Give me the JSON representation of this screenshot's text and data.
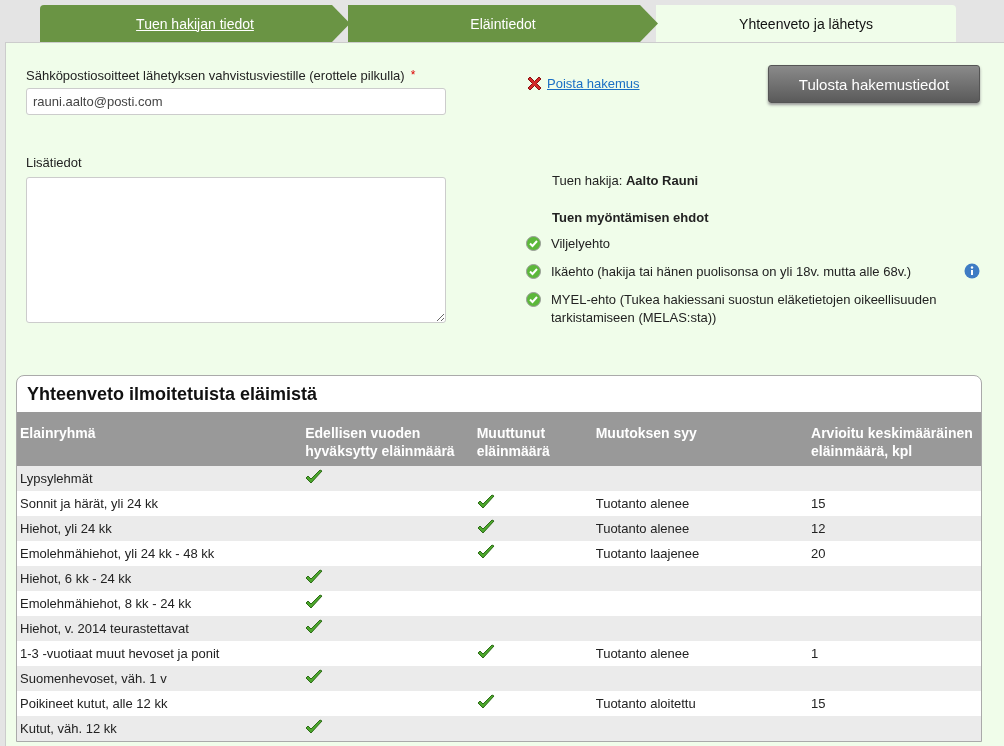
{
  "steps": [
    {
      "label": "Tuen hakijan tiedot",
      "selected": false,
      "link": true
    },
    {
      "label": "Eläintiedot",
      "selected": false,
      "link": false
    },
    {
      "label": "Yhteenveto ja lähetys",
      "selected": true,
      "link": false
    }
  ],
  "email": {
    "label": "Sähköpostiosoitteet lähetyksen vahvistusviestille (erottele pilkulla)",
    "required_mark": "*",
    "value": "rauni.aalto@posti.com"
  },
  "notes": {
    "label": "Lisätiedot"
  },
  "delete_link": "Poista hakemus",
  "print_button": "Tulosta hakemustiedot",
  "applicant": {
    "label": "Tuen hakija:",
    "name": "Aalto Rauni"
  },
  "conditions": {
    "title": "Tuen myöntämisen ehdot",
    "items": [
      {
        "text": "Viljelyehto",
        "met": true,
        "info": false
      },
      {
        "text": "Ikäehto (hakija tai hänen puolisonsa on yli 18v. mutta alle 68v.)",
        "met": true,
        "info": true
      },
      {
        "text": "MYEL-ehto (Tukea hakiessani suostun eläketietojen oikeellisuuden tarkistamiseen (MELAS:sta))",
        "met": true,
        "info": false
      }
    ]
  },
  "summary": {
    "title": "Yhteenveto ilmoitetuista eläimistä",
    "columns": [
      "Elainryhmä",
      "Edellisen vuoden hyväksytty eläinmäärä",
      "Muuttunut eläinmäärä",
      "Muutoksen syy",
      "Arvioitu keskimääräinen eläinmäärä, kpl"
    ],
    "rows": [
      {
        "group": "Lypsylehmät",
        "previous": true,
        "changed": false,
        "reason": "",
        "estimate": ""
      },
      {
        "group": "Sonnit ja härät, yli 24 kk",
        "previous": false,
        "changed": true,
        "reason": "Tuotanto alenee",
        "estimate": "15"
      },
      {
        "group": "Hiehot, yli 24 kk",
        "previous": false,
        "changed": true,
        "reason": "Tuotanto alenee",
        "estimate": "12"
      },
      {
        "group": "Emolehmähiehot, yli 24 kk - 48 kk",
        "previous": false,
        "changed": true,
        "reason": "Tuotanto laajenee",
        "estimate": "20"
      },
      {
        "group": "Hiehot, 6 kk - 24 kk",
        "previous": true,
        "changed": false,
        "reason": "",
        "estimate": ""
      },
      {
        "group": "Emolehmähiehot, 8 kk - 24 kk",
        "previous": true,
        "changed": false,
        "reason": "",
        "estimate": ""
      },
      {
        "group": "Hiehot, v. 2014 teurastettavat",
        "previous": true,
        "changed": false,
        "reason": "",
        "estimate": ""
      },
      {
        "group": "1-3 -vuotiaat muut hevoset ja ponit",
        "previous": false,
        "changed": true,
        "reason": "Tuotanto alenee",
        "estimate": "1"
      },
      {
        "group": "Suomenhevoset, väh. 1 v",
        "previous": true,
        "changed": false,
        "reason": "",
        "estimate": ""
      },
      {
        "group": "Poikineet kutut, alle 12 kk",
        "previous": false,
        "changed": true,
        "reason": "Tuotanto aloitettu",
        "estimate": "15"
      },
      {
        "group": "Kutut, väh. 12 kk",
        "previous": true,
        "changed": false,
        "reason": "",
        "estimate": ""
      }
    ]
  }
}
